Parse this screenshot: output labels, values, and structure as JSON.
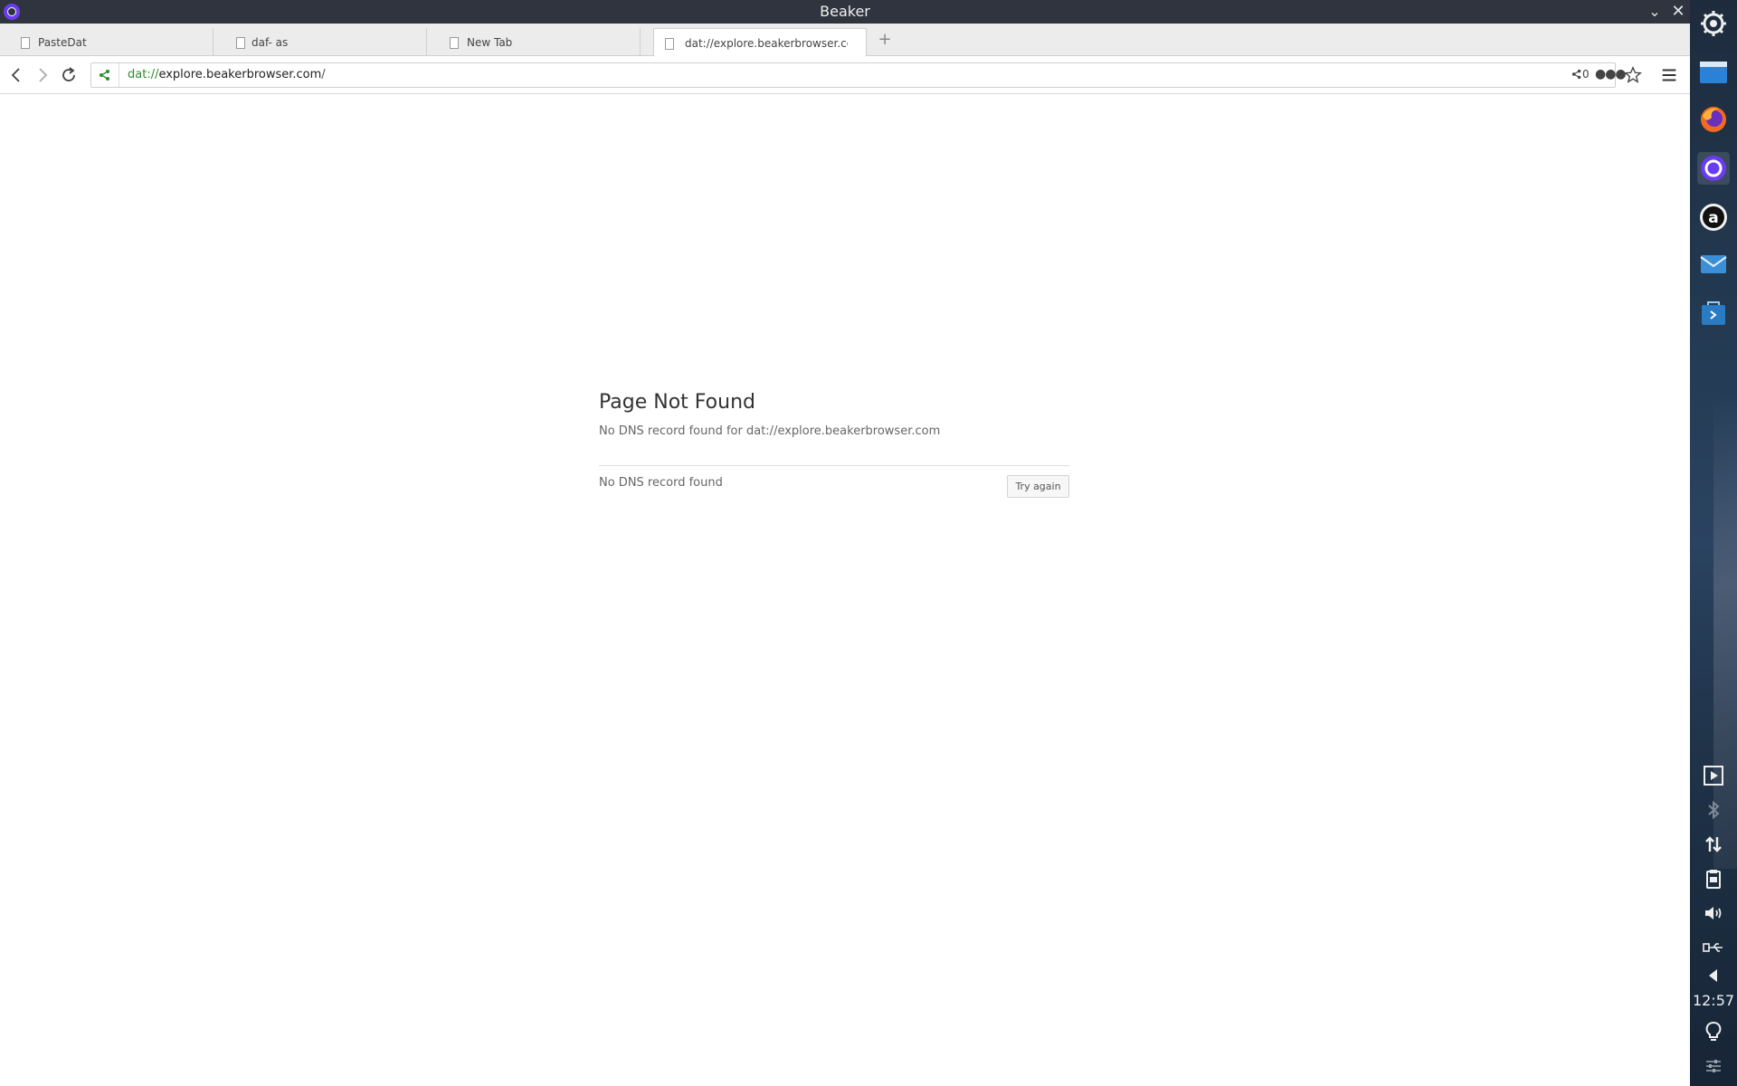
{
  "window": {
    "title": "Beaker"
  },
  "tabs": [
    {
      "label": "PasteDat",
      "active": false
    },
    {
      "label": "daf- as",
      "active": false
    },
    {
      "label": "New Tab",
      "active": false
    },
    {
      "label": "dat://explore.beakerbrowser.com",
      "active": true
    }
  ],
  "navbar": {
    "url_scheme": "dat://",
    "url_host": "explore.beakerbrowser.com",
    "url_tail": "/",
    "peer_count": "0"
  },
  "error": {
    "title": "Page Not Found",
    "description": "No DNS record found for dat://explore.beakerbrowser.com",
    "reason": "No DNS record found",
    "retry_label": "Try again"
  },
  "dock": {
    "apps": [
      "settings-icon",
      "file-manager-icon",
      "firefox-icon",
      "beaker-icon",
      "amazon-icon",
      "mail-icon",
      "store-icon"
    ],
    "tray": [
      "media-icon",
      "bluetooth-icon",
      "network-icon",
      "clipboard-icon",
      "volume-icon",
      "usb-icon",
      "back-arrow-icon"
    ],
    "time": "12:57"
  },
  "colors": {
    "titlebar": "#2f343f",
    "accent_purple": "#6a3cf0",
    "secure_green": "#2e8b2e"
  }
}
